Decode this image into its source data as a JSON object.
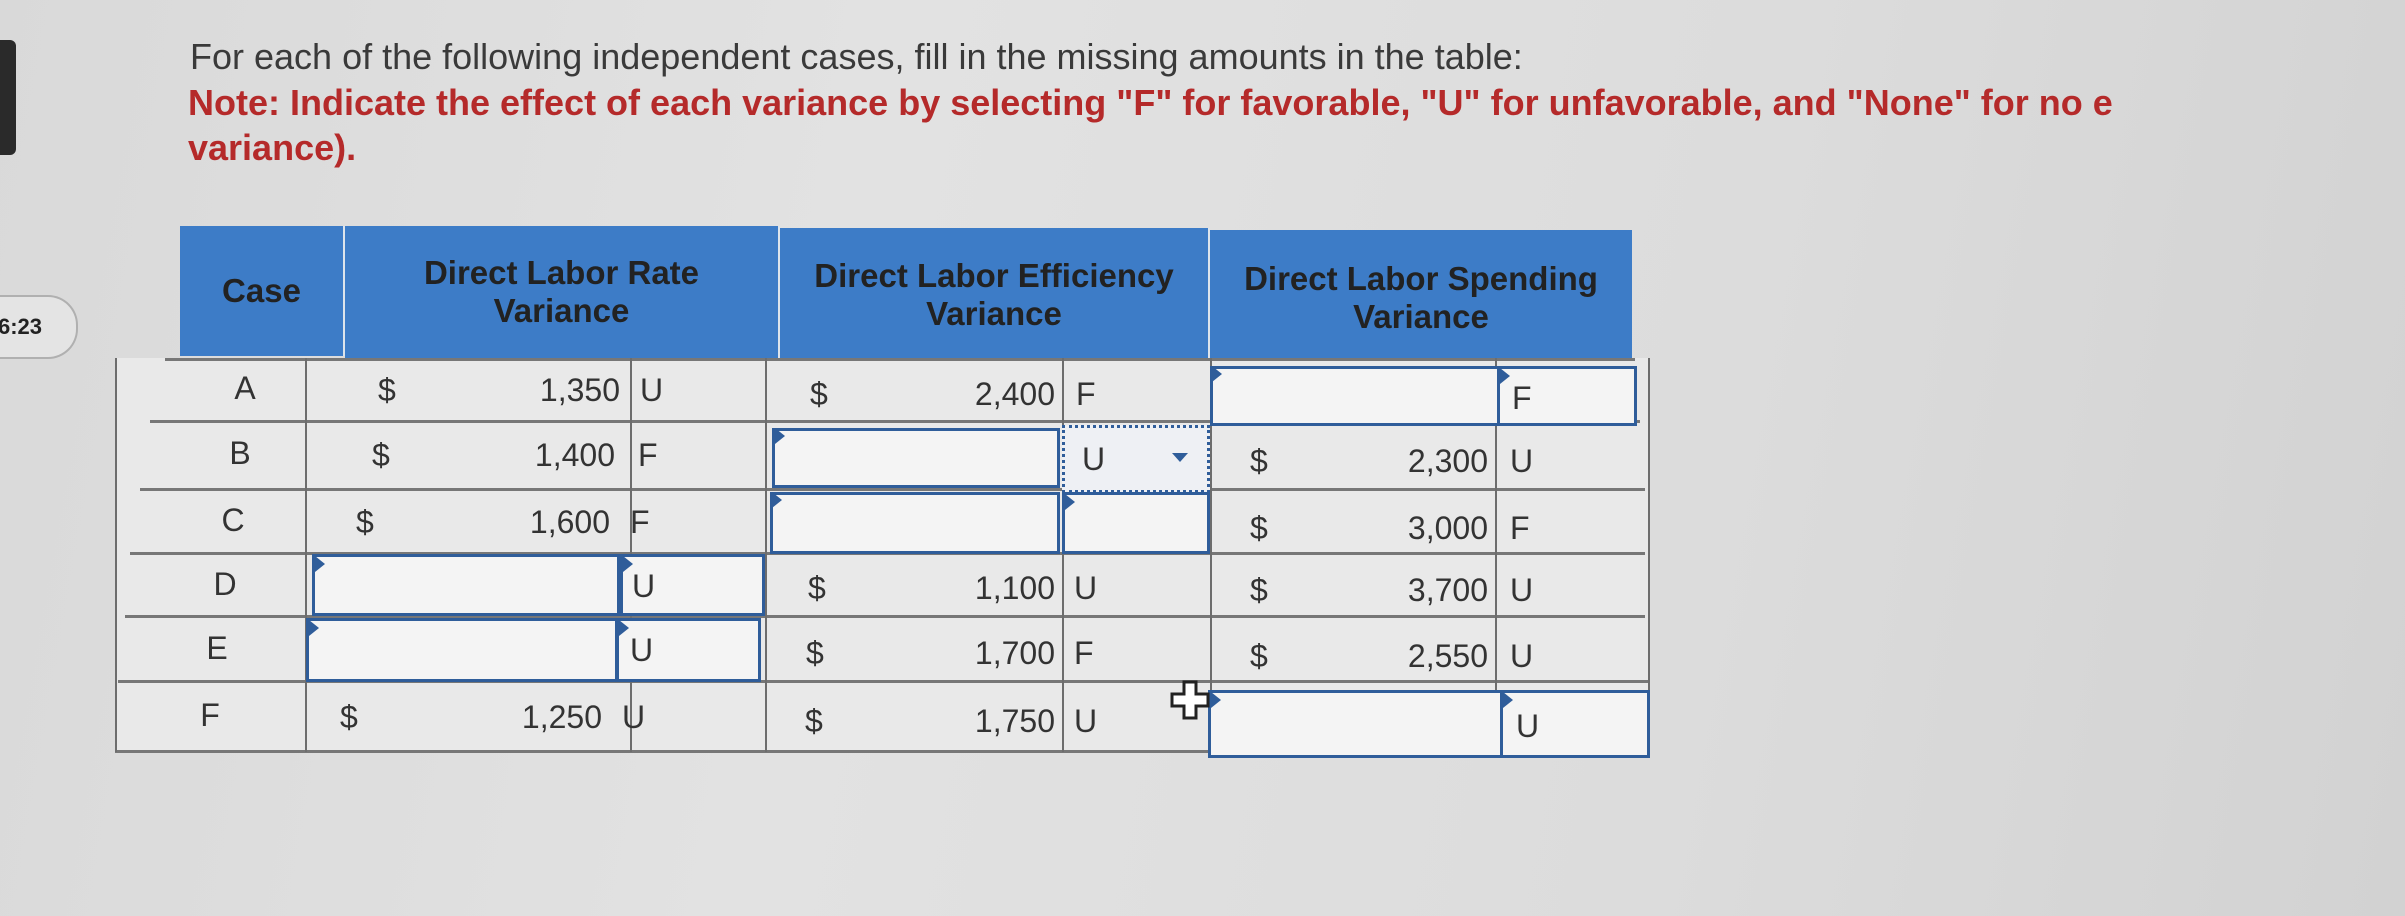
{
  "timer": "6:23",
  "instructions": {
    "intro": "For each of the following independent cases, fill in the missing amounts in the table:",
    "note_line1": "Note: Indicate the effect of each variance by selecting \"F\" for favorable, \"U\" for unfavorable, and \"None\" for no e",
    "note_line2": "variance)."
  },
  "table": {
    "headers": {
      "case": "Case",
      "rate": "Direct Labor Rate Variance",
      "efficiency": "Direct Labor Efficiency Variance",
      "spending": "Direct Labor Spending Variance"
    },
    "rows": [
      {
        "case": "A",
        "rate_dollar": "$",
        "rate_amount": "1,350",
        "rate_ind": "U",
        "eff_dollar": "$",
        "eff_amount": "2,400",
        "eff_ind": "F",
        "spend_dollar": "",
        "spend_amount": "",
        "spend_ind": "F"
      },
      {
        "case": "B",
        "rate_dollar": "$",
        "rate_amount": "1,400",
        "rate_ind": "F",
        "eff_dollar": "",
        "eff_amount": "",
        "eff_ind": "U",
        "spend_dollar": "$",
        "spend_amount": "2,300",
        "spend_ind": "U"
      },
      {
        "case": "C",
        "rate_dollar": "$",
        "rate_amount": "1,600",
        "rate_ind": "F",
        "eff_dollar": "",
        "eff_amount": "",
        "eff_ind": "",
        "spend_dollar": "$",
        "spend_amount": "3,000",
        "spend_ind": "F"
      },
      {
        "case": "D",
        "rate_dollar": "",
        "rate_amount": "",
        "rate_ind": "U",
        "eff_dollar": "$",
        "eff_amount": "1,100",
        "eff_ind": "U",
        "spend_dollar": "$",
        "spend_amount": "3,700",
        "spend_ind": "U"
      },
      {
        "case": "E",
        "rate_dollar": "",
        "rate_amount": "",
        "rate_ind": "U",
        "eff_dollar": "$",
        "eff_amount": "1,700",
        "eff_ind": "F",
        "spend_dollar": "$",
        "spend_amount": "2,550",
        "spend_ind": "U"
      },
      {
        "case": "F",
        "rate_dollar": "$",
        "rate_amount": "1,250",
        "rate_ind": "U",
        "eff_dollar": "$",
        "eff_amount": "1,750",
        "eff_ind": "U",
        "spend_dollar": "",
        "spend_amount": "",
        "spend_ind": "U"
      }
    ]
  },
  "icons": {
    "dropdown": "dropdown-arrow-icon",
    "cursor": "move-cursor-icon"
  }
}
